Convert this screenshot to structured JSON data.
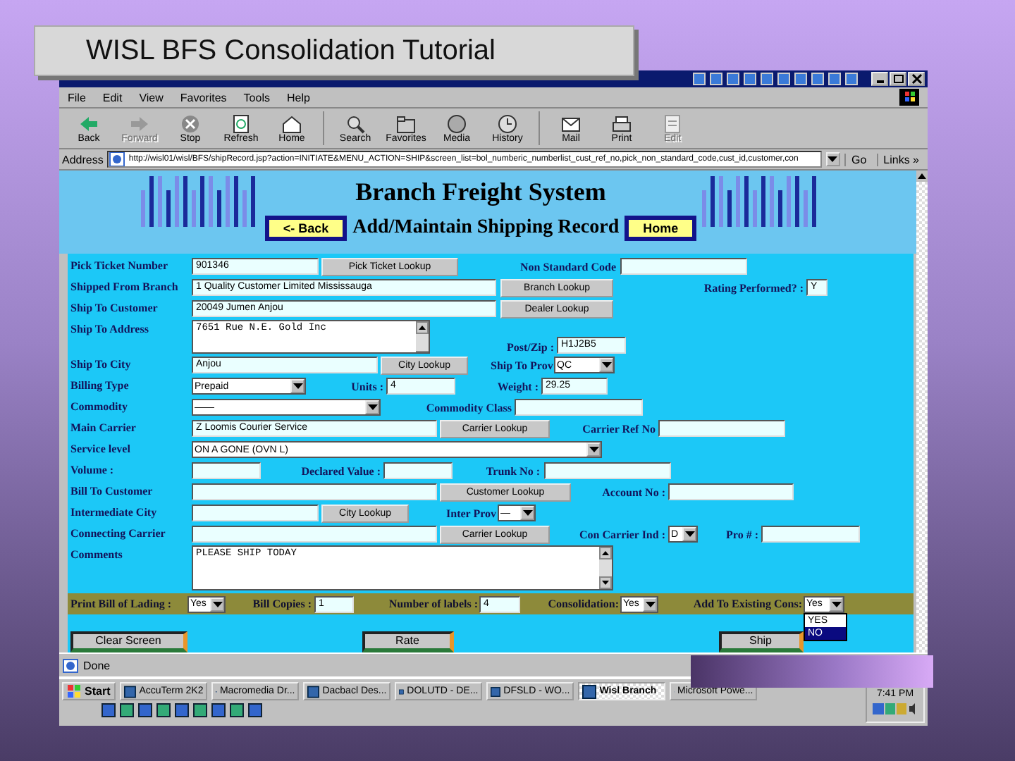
{
  "slide_title": "WISL BFS Consolidation Tutorial",
  "browser": {
    "menu": [
      "File",
      "Edit",
      "View",
      "Favorites",
      "Tools",
      "Help"
    ],
    "toolbar": [
      {
        "label": "Back",
        "disabled": false
      },
      {
        "label": "Forward",
        "disabled": true
      },
      {
        "label": "Stop",
        "disabled": false
      },
      {
        "label": "Refresh",
        "disabled": false
      },
      {
        "label": "Home",
        "disabled": false
      },
      {
        "label": "Search",
        "disabled": false
      },
      {
        "label": "Favorites",
        "disabled": false
      },
      {
        "label": "Media",
        "disabled": false
      },
      {
        "label": "History",
        "disabled": false
      },
      {
        "label": "Mail",
        "disabled": false
      },
      {
        "label": "Print",
        "disabled": false
      },
      {
        "label": "Edit",
        "disabled": true
      }
    ],
    "address": {
      "label": "Address",
      "url": "http://wisl01/wisl/BFS/shipRecord.jsp?action=INITIATE&MENU_ACTION=SHIP&screen_list=bol_numberic_numberlist_cust_ref_no,pick_non_standard_code,cust_id,customer,con",
      "go": "Go",
      "links": "Links »"
    }
  },
  "page": {
    "title": "Branch Freight System",
    "back_button": "<- Back",
    "subtitle": "Add/Maintain Shipping Record",
    "home_button": "Home"
  },
  "form": {
    "rows": [
      {
        "label": "Pick Ticket Number",
        "items": [
          {
            "kind": "input",
            "value": "901346"
          },
          {
            "kind": "button",
            "label": "Pick Ticket Lookup"
          },
          {
            "kind": "label",
            "text": "Non Standard Code"
          },
          {
            "kind": "input"
          }
        ]
      },
      {
        "label": "Shipped From Branch",
        "items": [
          {
            "kind": "input",
            "value": "1 Quality Customer Limited Mississauga"
          },
          {
            "kind": "button",
            "label": "Branch Lookup"
          },
          {
            "kind": "label",
            "text": "Rating Performed? :"
          },
          {
            "kind": "input",
            "value": "Y"
          }
        ]
      },
      {
        "label": "Ship To Customer",
        "items": [
          {
            "kind": "input",
            "value": "20049 Jumen Anjou"
          },
          {
            "kind": "button",
            "label": "Dealer Lookup"
          }
        ]
      },
      {
        "label": "Ship To Address",
        "items": [
          {
            "kind": "textarea",
            "value": "7651 Rue N.E. Gold Inc"
          },
          {
            "kind": "label",
            "text": "Post/Zip :"
          },
          {
            "kind": "input",
            "value": "H1J2B5"
          }
        ]
      },
      {
        "label": "Ship To City",
        "items": [
          {
            "kind": "input",
            "value": "Anjou"
          },
          {
            "kind": "button",
            "label": "City Lookup"
          },
          {
            "kind": "label",
            "text": "Ship To Prov"
          },
          {
            "kind": "select",
            "value": "QC"
          }
        ]
      },
      {
        "label": "Billing Type",
        "items": [
          {
            "kind": "select",
            "value": "Prepaid"
          },
          {
            "kind": "label",
            "text": "Units :"
          },
          {
            "kind": "input",
            "value": "4"
          },
          {
            "kind": "label",
            "text": "Weight :"
          },
          {
            "kind": "input",
            "value": "29.25"
          }
        ]
      },
      {
        "label": "Commodity",
        "items": [
          {
            "kind": "select",
            "value": "——"
          },
          {
            "kind": "label",
            "text": "Commodity Class"
          },
          {
            "kind": "input"
          }
        ]
      },
      {
        "label": "Main Carrier",
        "items": [
          {
            "kind": "input",
            "value": "Z Loomis Courier Service"
          },
          {
            "kind": "button",
            "label": "Carrier Lookup"
          },
          {
            "kind": "label",
            "text": "Carrier Ref No"
          },
          {
            "kind": "input"
          }
        ]
      },
      {
        "label": "Service level",
        "items": [
          {
            "kind": "select",
            "value": "ON A GONE (OVN L)"
          }
        ]
      },
      {
        "label": "Volume :",
        "items": [
          {
            "kind": "input"
          },
          {
            "kind": "label",
            "text": "Declared Value :"
          },
          {
            "kind": "input"
          },
          {
            "kind": "label",
            "text": "Trunk No :"
          },
          {
            "kind": "input"
          }
        ]
      },
      {
        "label": "Bill To Customer",
        "items": [
          {
            "kind": "input"
          },
          {
            "kind": "button",
            "label": "Customer Lookup"
          },
          {
            "kind": "label",
            "text": "Account No :"
          },
          {
            "kind": "input"
          }
        ]
      },
      {
        "label": "Intermediate City",
        "items": [
          {
            "kind": "input"
          },
          {
            "kind": "button",
            "label": "City Lookup"
          },
          {
            "kind": "label",
            "text": "Inter Prov"
          },
          {
            "kind": "select",
            "value": "—"
          }
        ]
      },
      {
        "label": "Connecting Carrier",
        "items": [
          {
            "kind": "input"
          },
          {
            "kind": "button",
            "label": "Carrier Lookup"
          },
          {
            "kind": "label",
            "text": "Con Carrier Ind :"
          },
          {
            "kind": "select",
            "value": "D"
          },
          {
            "kind": "label",
            "text": "Pro # :"
          },
          {
            "kind": "input"
          }
        ]
      },
      {
        "label": "Comments",
        "items": [
          {
            "kind": "textarea",
            "value": "PLEASE SHIP TODAY"
          }
        ]
      }
    ]
  },
  "options_bar": {
    "items": [
      {
        "kind": "label",
        "text": "Print Bill of Lading :"
      },
      {
        "kind": "select",
        "value": "Yes",
        "open": false
      },
      {
        "kind": "label",
        "text": "Bill Copies :"
      },
      {
        "kind": "input",
        "value": "1"
      },
      {
        "kind": "label",
        "text": "Number of labels :"
      },
      {
        "kind": "input",
        "value": "4"
      },
      {
        "kind": "label",
        "text": "Consolidation:"
      },
      {
        "kind": "select",
        "value": "Yes",
        "open": false
      },
      {
        "kind": "label",
        "text": "Add To Existing Cons:"
      },
      {
        "kind": "select",
        "value": "Yes",
        "open": true,
        "options": [
          {
            "label": "YES",
            "selected": false
          },
          {
            "label": "NO",
            "selected": true
          }
        ]
      }
    ]
  },
  "buttons": [
    "Clear Screen",
    "Rate",
    "Ship"
  ],
  "status_bar": {
    "text": "Done"
  },
  "taskbar": {
    "start": "Start",
    "tasks": [
      {
        "label": "AccuTerm 2K2",
        "selected": false
      },
      {
        "label": "Macromedia Dr...",
        "selected": false
      },
      {
        "label": "Dacbacl Des...",
        "selected": false
      },
      {
        "label": "DOLUTD - DE...",
        "selected": false
      },
      {
        "label": "DFSLD - WO...",
        "selected": false
      },
      {
        "label": "Wisl Branch",
        "selected": true
      },
      {
        "label": "Microsoft Powe...",
        "selected": false
      }
    ],
    "clock": "7:41 PM"
  }
}
